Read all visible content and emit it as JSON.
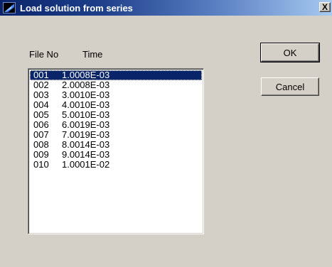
{
  "window": {
    "title": "Load solution from series",
    "close_glyph": "X"
  },
  "columns": {
    "file_no": "File No",
    "time": "Time"
  },
  "files": [
    {
      "no": "001",
      "time": "1.0008E-03",
      "selected": true
    },
    {
      "no": "002",
      "time": "2.0008E-03",
      "selected": false
    },
    {
      "no": "003",
      "time": "3.0010E-03",
      "selected": false
    },
    {
      "no": "004",
      "time": "4.0010E-03",
      "selected": false
    },
    {
      "no": "005",
      "time": "5.0010E-03",
      "selected": false
    },
    {
      "no": "006",
      "time": "6.0019E-03",
      "selected": false
    },
    {
      "no": "007",
      "time": "7.0019E-03",
      "selected": false
    },
    {
      "no": "008",
      "time": "8.0014E-03",
      "selected": false
    },
    {
      "no": "009",
      "time": "9.0014E-03",
      "selected": false
    },
    {
      "no": "010",
      "time": "1.0001E-02",
      "selected": false
    }
  ],
  "buttons": {
    "ok": "OK",
    "cancel": "Cancel"
  },
  "colors": {
    "selection": "#0a246a",
    "dialog_face": "#d4d0c8"
  },
  "icons": {
    "app": "app-logo-icon",
    "close": "close-icon"
  }
}
